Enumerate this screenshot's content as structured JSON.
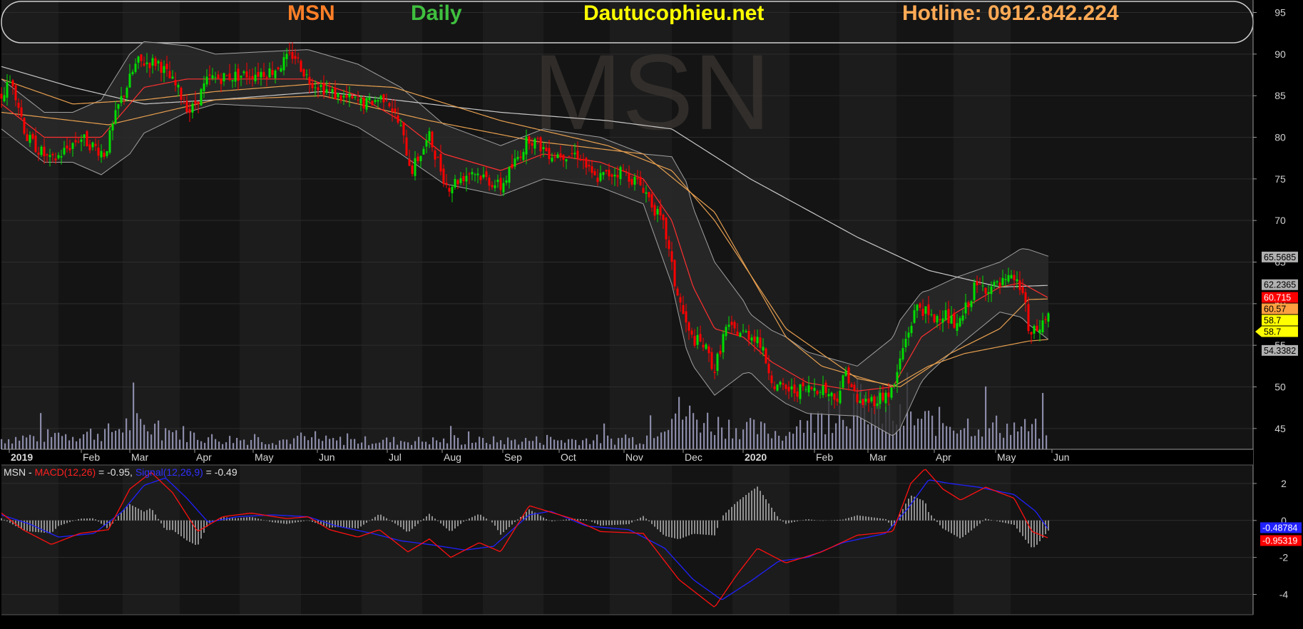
{
  "header": {
    "ticker": "MSN",
    "period": "Daily",
    "site": "Dautucophieu.net",
    "hotline": "Hotline: 0912.842.224"
  },
  "colors": {
    "ticker": "#ff7f27",
    "period": "#3fbf3f",
    "site": "#ffff00",
    "hotline": "#ffaa55",
    "up_candle": "#00dd00",
    "down_candle": "#ff0000",
    "sma_long": "#c8c8c8",
    "sma_mid": "#e8a050",
    "sma_short": "#ff3030",
    "bollinger": "#a0a0a0",
    "macd": "#ff1010",
    "signal": "#2020ff",
    "volume": "#8a8aa8"
  },
  "watermark": "MSN",
  "macd_legend": {
    "prefix": "MSN - ",
    "macd_label": "MACD(12,26)",
    "macd_value": " = -0.95, ",
    "signal_label": "Signal(12,26,9)",
    "signal_value": " = -0.49"
  },
  "price_badges": [
    {
      "text": "65.5685",
      "value": 65.5685,
      "bg": "#b0b0b0",
      "fg": "#000000"
    },
    {
      "text": "62.2365",
      "value": 62.2365,
      "bg": "#b0b0b0",
      "fg": "#000000"
    },
    {
      "text": "60.715",
      "value": 60.715,
      "bg": "#ff0000",
      "fg": "#ffffff"
    },
    {
      "text": "60.57",
      "value": 60.57,
      "bg": "#ffa040",
      "fg": "#000000"
    },
    {
      "text": "58.7",
      "value": 58.7,
      "bg": "#ffff00",
      "fg": "#000000"
    },
    {
      "text": "58.7",
      "value": 58.7,
      "bg": "#ffff00",
      "fg": "#000000"
    },
    {
      "text": "54.3382",
      "value": 54.3382,
      "bg": "#b0b0b0",
      "fg": "#000000"
    }
  ],
  "macd_badges": [
    {
      "text": "-0.48784",
      "value": -0.48784,
      "bg": "#2020ff",
      "fg": "#ffffff"
    },
    {
      "text": "-0.95319",
      "value": -0.95319,
      "bg": "#ff0000",
      "fg": "#ffffff"
    }
  ],
  "chart_data": {
    "type": "candlestick",
    "ticker": "MSN",
    "interval": "Daily",
    "x_tick_labels": [
      "2019",
      "Feb",
      "Mar",
      "Apr",
      "May",
      "Jun",
      "Jul",
      "Aug",
      "Sep",
      "Oct",
      "Nov",
      "Dec",
      "2020",
      "Feb",
      "Mar",
      "Apr",
      "May",
      "Jun"
    ],
    "y_ticks": [
      45,
      50,
      55,
      60,
      65,
      70,
      75,
      80,
      85,
      90,
      95
    ],
    "ylim": [
      42.5,
      96.5
    ],
    "grid": true,
    "price_key": [
      {
        "x": 0,
        "y": 85
      },
      {
        "x": 15,
        "y": 87
      },
      {
        "x": 35,
        "y": 80
      },
      {
        "x": 70,
        "y": 77
      },
      {
        "x": 110,
        "y": 80
      },
      {
        "x": 145,
        "y": 78
      },
      {
        "x": 165,
        "y": 84
      },
      {
        "x": 190,
        "y": 89
      },
      {
        "x": 220,
        "y": 89
      },
      {
        "x": 245,
        "y": 86
      },
      {
        "x": 265,
        "y": 83
      },
      {
        "x": 290,
        "y": 87
      },
      {
        "x": 340,
        "y": 87.5
      },
      {
        "x": 380,
        "y": 88
      },
      {
        "x": 410,
        "y": 90
      },
      {
        "x": 430,
        "y": 87
      },
      {
        "x": 470,
        "y": 85
      },
      {
        "x": 510,
        "y": 84
      },
      {
        "x": 540,
        "y": 85
      },
      {
        "x": 560,
        "y": 81
      },
      {
        "x": 575,
        "y": 76
      },
      {
        "x": 600,
        "y": 80
      },
      {
        "x": 625,
        "y": 74
      },
      {
        "x": 660,
        "y": 76
      },
      {
        "x": 700,
        "y": 74
      },
      {
        "x": 740,
        "y": 80
      },
      {
        "x": 770,
        "y": 78
      },
      {
        "x": 810,
        "y": 78
      },
      {
        "x": 830,
        "y": 75
      },
      {
        "x": 870,
        "y": 76
      },
      {
        "x": 900,
        "y": 74
      },
      {
        "x": 930,
        "y": 69
      },
      {
        "x": 945,
        "y": 62
      },
      {
        "x": 965,
        "y": 56
      },
      {
        "x": 985,
        "y": 55
      },
      {
        "x": 1000,
        "y": 52
      },
      {
        "x": 1015,
        "y": 57
      },
      {
        "x": 1060,
        "y": 56
      },
      {
        "x": 1085,
        "y": 50
      },
      {
        "x": 1110,
        "y": 49.5
      },
      {
        "x": 1150,
        "y": 50
      },
      {
        "x": 1170,
        "y": 48.5
      },
      {
        "x": 1185,
        "y": 52
      },
      {
        "x": 1200,
        "y": 48
      },
      {
        "x": 1225,
        "y": 48.5
      },
      {
        "x": 1250,
        "y": 49.5
      },
      {
        "x": 1265,
        "y": 55
      },
      {
        "x": 1285,
        "y": 60
      },
      {
        "x": 1305,
        "y": 58
      },
      {
        "x": 1320,
        "y": 59
      },
      {
        "x": 1340,
        "y": 57
      },
      {
        "x": 1365,
        "y": 62
      },
      {
        "x": 1395,
        "y": 62
      },
      {
        "x": 1420,
        "y": 63
      },
      {
        "x": 1435,
        "y": 61
      },
      {
        "x": 1440,
        "y": 56
      },
      {
        "x": 1455,
        "y": 57
      },
      {
        "x": 1468,
        "y": 58.7
      }
    ],
    "sma_long_key": [
      {
        "x": 0,
        "y": 88.5
      },
      {
        "x": 100,
        "y": 86
      },
      {
        "x": 200,
        "y": 84
      },
      {
        "x": 300,
        "y": 84.5
      },
      {
        "x": 450,
        "y": 85.5
      },
      {
        "x": 550,
        "y": 84.5
      },
      {
        "x": 700,
        "y": 83
      },
      {
        "x": 850,
        "y": 82
      },
      {
        "x": 940,
        "y": 81
      },
      {
        "x": 1050,
        "y": 75
      },
      {
        "x": 1200,
        "y": 68
      },
      {
        "x": 1300,
        "y": 64
      },
      {
        "x": 1400,
        "y": 62
      },
      {
        "x": 1468,
        "y": 62.2
      }
    ],
    "sma_mid_key": [
      {
        "x": 0,
        "y": 87
      },
      {
        "x": 100,
        "y": 84
      },
      {
        "x": 200,
        "y": 84.5
      },
      {
        "x": 300,
        "y": 85.5
      },
      {
        "x": 450,
        "y": 86.5
      },
      {
        "x": 550,
        "y": 86
      },
      {
        "x": 700,
        "y": 82
      },
      {
        "x": 850,
        "y": 79
      },
      {
        "x": 940,
        "y": 76
      },
      {
        "x": 1000,
        "y": 70
      },
      {
        "x": 1100,
        "y": 57
      },
      {
        "x": 1200,
        "y": 51
      },
      {
        "x": 1260,
        "y": 50
      },
      {
        "x": 1330,
        "y": 54
      },
      {
        "x": 1400,
        "y": 57
      },
      {
        "x": 1440,
        "y": 60.5
      },
      {
        "x": 1468,
        "y": 60.57
      }
    ],
    "sma_mid2_key": [
      {
        "x": 0,
        "y": 83
      },
      {
        "x": 150,
        "y": 81.5
      },
      {
        "x": 300,
        "y": 84.5
      },
      {
        "x": 450,
        "y": 85
      },
      {
        "x": 600,
        "y": 82
      },
      {
        "x": 750,
        "y": 79.5
      },
      {
        "x": 900,
        "y": 78
      },
      {
        "x": 1000,
        "y": 71
      },
      {
        "x": 1100,
        "y": 56
      },
      {
        "x": 1150,
        "y": 52.5
      },
      {
        "x": 1250,
        "y": 50
      },
      {
        "x": 1300,
        "y": 52.5
      },
      {
        "x": 1350,
        "y": 54
      },
      {
        "x": 1440,
        "y": 55.5
      },
      {
        "x": 1468,
        "y": 55.7
      }
    ],
    "sma_short_key": [
      {
        "x": 0,
        "y": 84
      },
      {
        "x": 60,
        "y": 80
      },
      {
        "x": 140,
        "y": 80
      },
      {
        "x": 200,
        "y": 86
      },
      {
        "x": 260,
        "y": 87
      },
      {
        "x": 350,
        "y": 87
      },
      {
        "x": 430,
        "y": 87
      },
      {
        "x": 500,
        "y": 85
      },
      {
        "x": 560,
        "y": 82
      },
      {
        "x": 620,
        "y": 78
      },
      {
        "x": 700,
        "y": 76
      },
      {
        "x": 760,
        "y": 78
      },
      {
        "x": 840,
        "y": 77
      },
      {
        "x": 900,
        "y": 75
      },
      {
        "x": 940,
        "y": 70
      },
      {
        "x": 970,
        "y": 62
      },
      {
        "x": 1000,
        "y": 57
      },
      {
        "x": 1040,
        "y": 56
      },
      {
        "x": 1080,
        "y": 53
      },
      {
        "x": 1130,
        "y": 50.5
      },
      {
        "x": 1200,
        "y": 49.5
      },
      {
        "x": 1250,
        "y": 50
      },
      {
        "x": 1290,
        "y": 56
      },
      {
        "x": 1340,
        "y": 59
      },
      {
        "x": 1400,
        "y": 62
      },
      {
        "x": 1430,
        "y": 62.5
      },
      {
        "x": 1468,
        "y": 60.7
      }
    ],
    "bb_width_key": [
      {
        "x": 0,
        "y": 3
      },
      {
        "x": 100,
        "y": 3
      },
      {
        "x": 180,
        "y": 6
      },
      {
        "x": 300,
        "y": 3
      },
      {
        "x": 420,
        "y": 3.5
      },
      {
        "x": 560,
        "y": 4
      },
      {
        "x": 700,
        "y": 3
      },
      {
        "x": 900,
        "y": 3
      },
      {
        "x": 960,
        "y": 10
      },
      {
        "x": 1000,
        "y": 8
      },
      {
        "x": 1050,
        "y": 3.5
      },
      {
        "x": 1100,
        "y": 4
      },
      {
        "x": 1200,
        "y": 3
      },
      {
        "x": 1260,
        "y": 6.5
      },
      {
        "x": 1300,
        "y": 5
      },
      {
        "x": 1400,
        "y": 3
      },
      {
        "x": 1440,
        "y": 4.5
      },
      {
        "x": 1468,
        "y": 5
      }
    ],
    "volume_key": [
      {
        "x": 0,
        "y": 0.12
      },
      {
        "x": 150,
        "y": 0.2
      },
      {
        "x": 180,
        "y": 0.3
      },
      {
        "x": 300,
        "y": 0.12
      },
      {
        "x": 500,
        "y": 0.1
      },
      {
        "x": 700,
        "y": 0.1
      },
      {
        "x": 900,
        "y": 0.12
      },
      {
        "x": 940,
        "y": 0.45
      },
      {
        "x": 1000,
        "y": 0.3
      },
      {
        "x": 1100,
        "y": 0.18
      },
      {
        "x": 1200,
        "y": 0.55
      },
      {
        "x": 1260,
        "y": 0.35
      },
      {
        "x": 1350,
        "y": 0.3
      },
      {
        "x": 1468,
        "y": 0.22
      }
    ],
    "macd_panel": {
      "title": "MSN - MACD(12,26) = -0.95, Signal(12,26,9) = -0.49",
      "y_ticks": [
        2,
        0,
        -2,
        -4
      ],
      "ylim": [
        -5.1,
        3.0
      ],
      "macd_key": [
        {
          "x": 0,
          "y": 0.4
        },
        {
          "x": 30,
          "y": -0.5
        },
        {
          "x": 70,
          "y": -1.3
        },
        {
          "x": 110,
          "y": -0.7
        },
        {
          "x": 150,
          "y": -0.5
        },
        {
          "x": 180,
          "y": 1.7
        },
        {
          "x": 210,
          "y": 2.6
        },
        {
          "x": 240,
          "y": 1.5
        },
        {
          "x": 275,
          "y": -0.6
        },
        {
          "x": 310,
          "y": 0.2
        },
        {
          "x": 350,
          "y": 0.4
        },
        {
          "x": 400,
          "y": 0.1
        },
        {
          "x": 430,
          "y": 0.2
        },
        {
          "x": 460,
          "y": -0.5
        },
        {
          "x": 500,
          "y": -0.9
        },
        {
          "x": 530,
          "y": -0.5
        },
        {
          "x": 570,
          "y": -1.7
        },
        {
          "x": 600,
          "y": -1.0
        },
        {
          "x": 630,
          "y": -2.0
        },
        {
          "x": 670,
          "y": -1.2
        },
        {
          "x": 700,
          "y": -1.7
        },
        {
          "x": 740,
          "y": 0.8
        },
        {
          "x": 800,
          "y": 0.1
        },
        {
          "x": 840,
          "y": -0.6
        },
        {
          "x": 900,
          "y": -0.7
        },
        {
          "x": 950,
          "y": -3.2
        },
        {
          "x": 1000,
          "y": -4.7
        },
        {
          "x": 1030,
          "y": -3.0
        },
        {
          "x": 1060,
          "y": -1.5
        },
        {
          "x": 1100,
          "y": -2.3
        },
        {
          "x": 1150,
          "y": -1.7
        },
        {
          "x": 1200,
          "y": -0.8
        },
        {
          "x": 1250,
          "y": -0.6
        },
        {
          "x": 1275,
          "y": 2.0
        },
        {
          "x": 1295,
          "y": 2.8
        },
        {
          "x": 1320,
          "y": 1.7
        },
        {
          "x": 1345,
          "y": 1.1
        },
        {
          "x": 1380,
          "y": 1.8
        },
        {
          "x": 1420,
          "y": 1.2
        },
        {
          "x": 1445,
          "y": -0.6
        },
        {
          "x": 1468,
          "y": -0.95
        }
      ],
      "signal_key": [
        {
          "x": 0,
          "y": 0.3
        },
        {
          "x": 40,
          "y": -0.2
        },
        {
          "x": 80,
          "y": -0.9
        },
        {
          "x": 130,
          "y": -0.7
        },
        {
          "x": 170,
          "y": 0.5
        },
        {
          "x": 200,
          "y": 1.9
        },
        {
          "x": 230,
          "y": 2.3
        },
        {
          "x": 260,
          "y": 1.2
        },
        {
          "x": 290,
          "y": -0.1
        },
        {
          "x": 330,
          "y": 0.2
        },
        {
          "x": 380,
          "y": 0.3
        },
        {
          "x": 430,
          "y": 0.2
        },
        {
          "x": 470,
          "y": -0.3
        },
        {
          "x": 520,
          "y": -0.7
        },
        {
          "x": 560,
          "y": -1.1
        },
        {
          "x": 600,
          "y": -1.3
        },
        {
          "x": 650,
          "y": -1.6
        },
        {
          "x": 690,
          "y": -1.4
        },
        {
          "x": 740,
          "y": 0.3
        },
        {
          "x": 770,
          "y": 0.5
        },
        {
          "x": 820,
          "y": -0.3
        },
        {
          "x": 880,
          "y": -0.5
        },
        {
          "x": 930,
          "y": -1.5
        },
        {
          "x": 970,
          "y": -3.2
        },
        {
          "x": 1010,
          "y": -4.3
        },
        {
          "x": 1050,
          "y": -3.3
        },
        {
          "x": 1090,
          "y": -2.2
        },
        {
          "x": 1130,
          "y": -2.0
        },
        {
          "x": 1180,
          "y": -1.2
        },
        {
          "x": 1240,
          "y": -0.7
        },
        {
          "x": 1270,
          "y": 0.6
        },
        {
          "x": 1300,
          "y": 2.2
        },
        {
          "x": 1330,
          "y": 2.0
        },
        {
          "x": 1370,
          "y": 1.8
        },
        {
          "x": 1420,
          "y": 1.4
        },
        {
          "x": 1450,
          "y": 0.5
        },
        {
          "x": 1468,
          "y": -0.49
        }
      ]
    }
  }
}
